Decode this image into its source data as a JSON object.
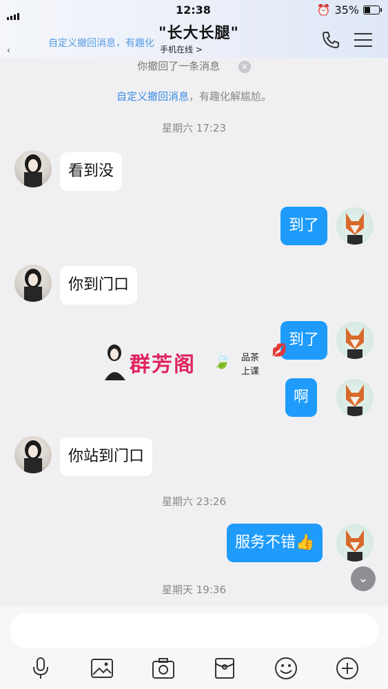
{
  "status_bar": {
    "time": "12:38",
    "battery": "35%"
  },
  "header": {
    "title": "\"长大长腿\"",
    "subtitle": "手机在线 >",
    "ghost_text": "自定义撤回消息，有趣化"
  },
  "recall_notice": "你撤回了一条消息",
  "custom_recall": {
    "link": "自定义撤回消息",
    "rest": "，有趣化解尴尬。"
  },
  "timestamps": [
    "星期六 17:23",
    "星期六 23:26",
    "星期天 19:36"
  ],
  "messages": [
    {
      "side": "in",
      "text": "看到没"
    },
    {
      "side": "out",
      "text": "到了"
    },
    {
      "side": "in",
      "text": "你到门口"
    },
    {
      "side": "out",
      "text": "到了"
    },
    {
      "side": "out",
      "text": "啊"
    },
    {
      "side": "in",
      "text": "你站到门口"
    },
    {
      "side": "out",
      "text": "服务不错👍"
    }
  ],
  "watermark": {
    "name": "群芳阁",
    "line1": "品茶",
    "line2": "上课"
  },
  "icons": {
    "header": [
      "phone-icon",
      "menu-icon"
    ],
    "toolbar": [
      "microphone-icon",
      "image-icon",
      "camera-icon",
      "red-packet-icon",
      "emoji-icon",
      "plus-icon"
    ]
  },
  "colors": {
    "outgoing_bubble": "#1e9bfb",
    "incoming_bubble": "#ffffff",
    "link": "#3b8be2"
  }
}
